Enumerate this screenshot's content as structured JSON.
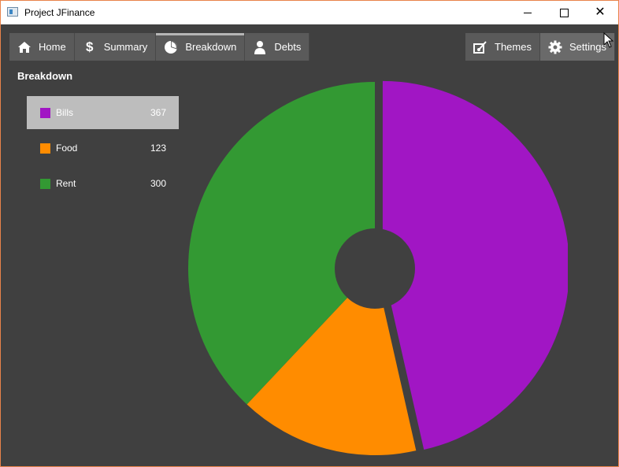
{
  "window": {
    "title": "Project JFinance"
  },
  "nav": {
    "tabs": [
      {
        "label": "Home",
        "icon": "home-icon"
      },
      {
        "label": "Summary",
        "icon": "dollar-icon"
      },
      {
        "label": "Breakdown",
        "icon": "pie-chart-icon"
      },
      {
        "label": "Debts",
        "icon": "person-icon"
      }
    ],
    "active_tab": "Breakdown",
    "right_tabs": [
      {
        "label": "Themes",
        "icon": "themes-icon"
      },
      {
        "label": "Settings",
        "icon": "gear-icon"
      }
    ]
  },
  "section": {
    "title": "Breakdown"
  },
  "legend": {
    "selected": "Bills",
    "items": [
      {
        "label": "Bills",
        "value": "367",
        "color": "#a116c4"
      },
      {
        "label": "Food",
        "value": "123",
        "color": "#ff8c00"
      },
      {
        "label": "Rent",
        "value": "300",
        "color": "#339933"
      }
    ]
  },
  "chart_data": {
    "type": "pie",
    "style": "donut",
    "categories": [
      "Bills",
      "Food",
      "Rent"
    ],
    "values": [
      367,
      123,
      300
    ],
    "colors": [
      "#a116c4",
      "#ff8c00",
      "#339933"
    ],
    "exploded": "Bills"
  }
}
